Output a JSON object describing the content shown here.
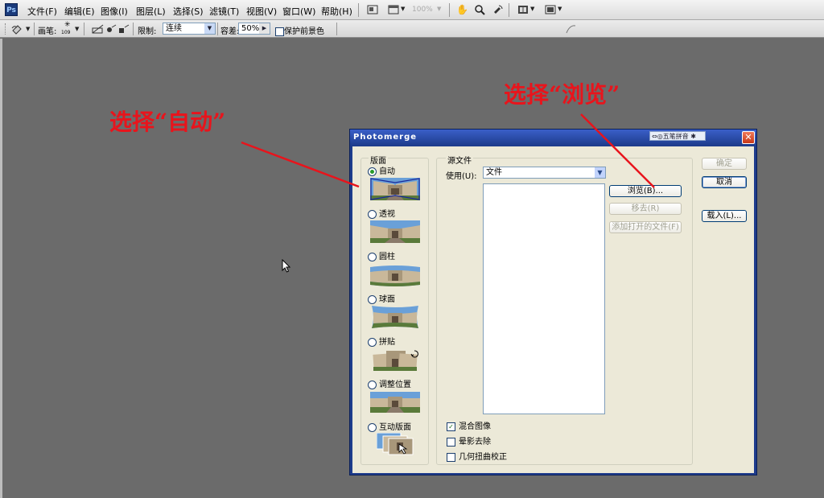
{
  "app": {
    "logo": "Ps"
  },
  "menu": [
    {
      "id": "file",
      "label": "文件(F)"
    },
    {
      "id": "edit",
      "label": "编辑(E)"
    },
    {
      "id": "image",
      "label": "图像(I)"
    },
    {
      "id": "layer",
      "label": "图层(L)"
    },
    {
      "id": "select",
      "label": "选择(S)"
    },
    {
      "id": "filter",
      "label": "滤镜(T)"
    },
    {
      "id": "view",
      "label": "视图(V)"
    },
    {
      "id": "window",
      "label": "窗口(W)"
    },
    {
      "id": "help",
      "label": "帮助(H)"
    }
  ],
  "toolbar": {
    "zoom": "100%"
  },
  "options": {
    "brush_label": "画笔:",
    "brush_size": "109",
    "limits_label": "限制:",
    "limits_value": "连续",
    "tolerance_label": "容差:",
    "tolerance_value": "50%",
    "protect_fg_label": "保护前景色"
  },
  "annotations": {
    "select_auto": "选择“自动”",
    "select_browse": "选择“浏览”"
  },
  "dialog": {
    "title": "Photomerge",
    "ime_bar": "五笔拼音",
    "layout": {
      "group_title": "版面",
      "options": [
        {
          "id": "auto",
          "label": "自动",
          "selected": true
        },
        {
          "id": "perspective",
          "label": "透视",
          "selected": false
        },
        {
          "id": "cylindrical",
          "label": "圆柱",
          "selected": false
        },
        {
          "id": "spherical",
          "label": "球面",
          "selected": false
        },
        {
          "id": "collage",
          "label": "拼贴",
          "selected": false
        },
        {
          "id": "reposition",
          "label": "调整位置",
          "selected": false
        },
        {
          "id": "interactive",
          "label": "互动版面",
          "selected": false
        }
      ]
    },
    "source": {
      "group_title": "源文件",
      "use_label": "使用(U):",
      "use_value": "文件",
      "browse_button": "浏览(B)...",
      "remove_button": "移去(R)",
      "add_open_button": "添加打开的文件(F)",
      "checks": [
        {
          "id": "blend",
          "label": "混合图像",
          "checked": true
        },
        {
          "id": "vignette",
          "label": "晕影去除",
          "checked": false
        },
        {
          "id": "distortion",
          "label": "几何扭曲校正",
          "checked": false
        }
      ]
    },
    "buttons": {
      "ok": "确定",
      "cancel": "取消",
      "load": "载入(L)..."
    }
  },
  "colors": {
    "annotation": "#e8141c",
    "title_bar": "#1e3c8c",
    "canvas": "#6b6b6b",
    "dialog_bg": "#ece9d8"
  }
}
